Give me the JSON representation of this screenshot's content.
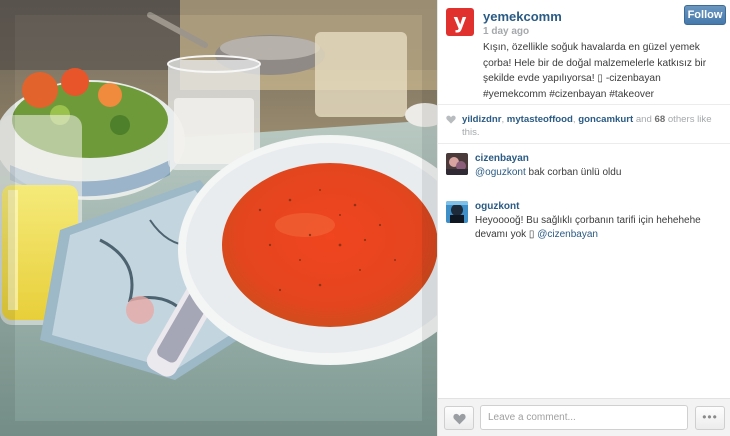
{
  "post": {
    "username": "yemekcomm",
    "logo_letter": "y",
    "time_ago": "1 day ago",
    "follow_label": "Follow",
    "caption_line": "Kışın, özellikle soğuk havalarda en güzel yemek çorba! Hele bir de doğal malzemelerle katkısız bir şekilde evde yapılıyorsa! ▯ -cizenbayan",
    "hashtags": "#yemekcomm #cizenbayan #takeover"
  },
  "likes": {
    "user1": "yildizdnr",
    "sep1": ", ",
    "user2": "mytasteoffood",
    "sep2": ", ",
    "user3": "goncamkurt",
    "and": " and ",
    "count": "68",
    "suffix": " others like this."
  },
  "comments": [
    {
      "user": "cizenbayan",
      "mention": "@oguzkont",
      "text": " bak corban ünlü oldu"
    },
    {
      "user": "oguzkont",
      "text": "Heyooooğ! Bu sağlıklı çorbanın tarifi için hehehehe devamı yok ▯ ",
      "mention": "@cizenbayan"
    }
  ],
  "footer": {
    "comment_placeholder": "Leave a comment...",
    "more_label": "•••"
  },
  "icons": {
    "logo": "yemekcomm-logo-icon",
    "heart": "heart-icon",
    "more": "more-options-icon"
  },
  "colors": {
    "username_blue": "#2a5b84",
    "follow_button": "#4679ac",
    "logo_red": "#e0312f",
    "muted_text": "#a5a9ac"
  }
}
